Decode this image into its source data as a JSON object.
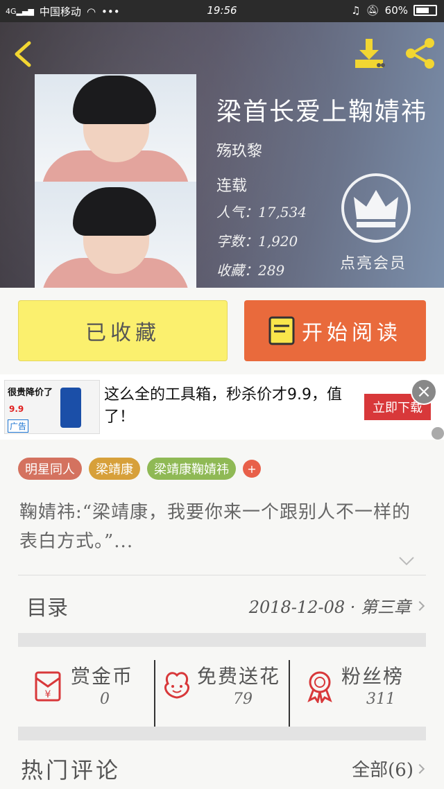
{
  "status_bar": {
    "carrier": "中国移动",
    "signal_label": "4G",
    "time": "19:56",
    "battery": "60%"
  },
  "book": {
    "title": "梁首长爱上鞠婧祎",
    "author": "殇玖黎",
    "status": "连载",
    "popularity_label": "人气：",
    "popularity": "17,534",
    "wordcount_label": "字数：",
    "wordcount": "1,920",
    "favorites_label": "收藏：",
    "favorites": "289",
    "vip_label": "点亮会员"
  },
  "actions": {
    "collected_label": "已收藏",
    "read_label": "开始阅读"
  },
  "ad": {
    "text": "这么全的工具箱，秒杀价才9.9，值了！",
    "button_label": "立即下载",
    "image_promo": "很贵降价了",
    "image_price": "9.9",
    "image_tag": "广告",
    "close_label": "×"
  },
  "tags": [
    {
      "label": "明星同人",
      "color": "#d4725f"
    },
    {
      "label": "梁靖康",
      "color": "#d7a03a"
    },
    {
      "label": "梁靖康鞠婧祎",
      "color": "#8fb955"
    }
  ],
  "tag_add_label": "+",
  "description": "鞠婧祎:“梁靖康，我要你来一个跟别人不一样的表白方式。”...",
  "toc": {
    "label": "目录",
    "latest": "2018-12-08 · 第三章"
  },
  "stats": [
    {
      "label": "赏金币",
      "value": "0",
      "icon": "red-envelope-icon"
    },
    {
      "label": "免费送花",
      "value": "79",
      "icon": "flower-icon"
    },
    {
      "label": "粉丝榜",
      "value": "311",
      "icon": "medal-icon"
    }
  ],
  "hot_comments": {
    "label": "热门评论",
    "all_label": "全部(6)"
  },
  "colors": {
    "accent_orange": "#e96a3c",
    "collected_yellow": "#fbf06e",
    "icon_yellow": "#f2d632",
    "icon_red": "#d8383a"
  }
}
